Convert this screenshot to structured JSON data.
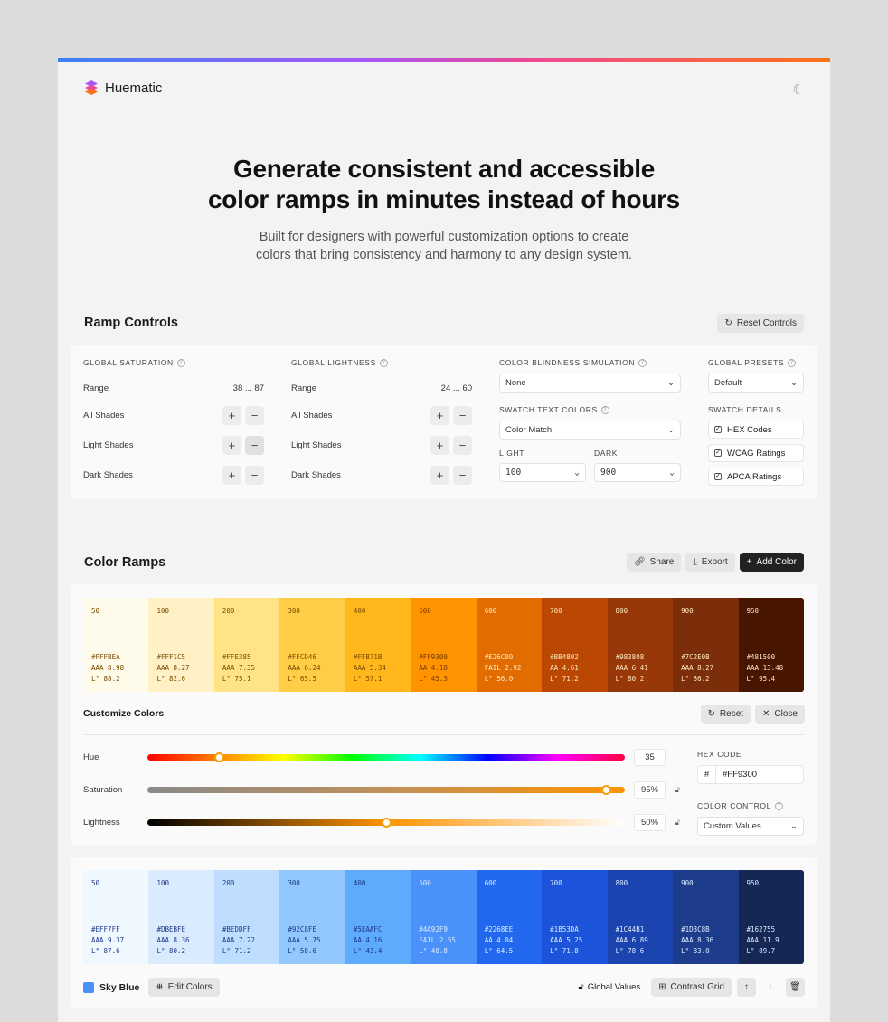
{
  "brand": {
    "name": "Huematic"
  },
  "hero": {
    "line1": "Generate consistent and accessible",
    "line2": "color ramps in minutes instead of hours",
    "sub1": "Built for designers with powerful customization options to create",
    "sub2": "colors that bring consistency and harmony to any design system."
  },
  "ramp_controls": {
    "title": "Ramp Controls",
    "reset": "Reset Controls",
    "sat": {
      "label": "Global Saturation",
      "range_label": "Range",
      "range": "38 ... 87"
    },
    "light": {
      "label": "Global Lightness",
      "range_label": "Range",
      "range": "24 ... 60"
    },
    "rows": [
      "All Shades",
      "Light Shades",
      "Dark Shades"
    ],
    "cb": {
      "label": "Color Blindness Simulation",
      "value": "None"
    },
    "stc": {
      "label": "Swatch Text Colors",
      "value": "Color Match",
      "light_label": "Light",
      "light_value": "100",
      "dark_label": "Dark",
      "dark_value": "900"
    },
    "presets": {
      "label": "Global Presets",
      "value": "Default"
    },
    "details": {
      "label": "Swatch Details",
      "items": [
        "HEX Codes",
        "WCAG Ratings",
        "APCA Ratings"
      ]
    }
  },
  "color_ramps": {
    "title": "Color Ramps",
    "share": "Share",
    "export": "Export",
    "add": "Add Color"
  },
  "orange": [
    {
      "n": "50",
      "hex": "#FFFBEA",
      "wcag": "AAA 8.98",
      "apca": "L° 88.2",
      "bg": "#FFFBEA",
      "fg": "#7a4a00"
    },
    {
      "n": "100",
      "hex": "#FFF1C5",
      "wcag": "AAA 8.27",
      "apca": "L° 82.6",
      "bg": "#FFF1C5",
      "fg": "#7a4a00"
    },
    {
      "n": "200",
      "hex": "#FFE385",
      "wcag": "AAA 7.35",
      "apca": "L° 75.1",
      "bg": "#FFE385",
      "fg": "#7a4a00"
    },
    {
      "n": "300",
      "hex": "#FFCD46",
      "wcag": "AAA 6.24",
      "apca": "L° 65.5",
      "bg": "#FFCD46",
      "fg": "#7a4a00"
    },
    {
      "n": "400",
      "hex": "#FFB71B",
      "wcag": "AAA 5.34",
      "apca": "L° 57.1",
      "bg": "#FFB71B",
      "fg": "#7a4a00"
    },
    {
      "n": "500",
      "hex": "#FF9300",
      "wcag": "AA 4.18",
      "apca": "L° 45.3",
      "bg": "#FF9300",
      "fg": "#7a3a00"
    },
    {
      "n": "600",
      "hex": "#E26C00",
      "wcag": "FAIL 2.92",
      "apca": "L° 56.0",
      "bg": "#E26C00",
      "fg": "#FFE8C0"
    },
    {
      "n": "700",
      "hex": "#BB4802",
      "wcag": "AA 4.61",
      "apca": "L° 71.2",
      "bg": "#BB4802",
      "fg": "#FFE8C0"
    },
    {
      "n": "800",
      "hex": "#983808",
      "wcag": "AAA 6.41",
      "apca": "L° 80.2",
      "bg": "#983808",
      "fg": "#FFE8C0"
    },
    {
      "n": "900",
      "hex": "#7C2E0B",
      "wcag": "AAA 8.27",
      "apca": "L° 86.2",
      "bg": "#7C2E0B",
      "fg": "#FFE8C0"
    },
    {
      "n": "950",
      "hex": "#481500",
      "wcag": "AAA 13.48",
      "apca": "L° 95.4",
      "bg": "#481500",
      "fg": "#FFE8C0"
    }
  ],
  "customize": {
    "title": "Customize Colors",
    "reset": "Reset",
    "close": "Close",
    "hue": {
      "label": "Hue",
      "value": "35",
      "fraction": 0.15
    },
    "sat": {
      "label": "Saturation",
      "value": "95%",
      "fraction": 0.96
    },
    "light": {
      "label": "Lightness",
      "value": "50%",
      "fraction": 0.5
    },
    "hex_label": "Hex Code",
    "hash": "#",
    "hex": "#FF9300",
    "cc_label": "Color Control",
    "cc_value": "Custom Values"
  },
  "blue": [
    {
      "n": "50",
      "hex": "#EFF7FF",
      "wcag": "AAA 9.37",
      "apca": "L° 87.6",
      "bg": "#EFF7FF",
      "fg": "#1e3a8a"
    },
    {
      "n": "100",
      "hex": "#DBEBFE",
      "wcag": "AAA 8.36",
      "apca": "L° 80.2",
      "bg": "#DBEBFE",
      "fg": "#1e3a8a"
    },
    {
      "n": "200",
      "hex": "#BEDDFF",
      "wcag": "AAA 7.22",
      "apca": "L° 71.2",
      "bg": "#BEDDFF",
      "fg": "#1e3a8a"
    },
    {
      "n": "300",
      "hex": "#92C8FE",
      "wcag": "AAA 5.75",
      "apca": "L° 58.6",
      "bg": "#92C8FE",
      "fg": "#1e3a8a"
    },
    {
      "n": "400",
      "hex": "#5EAAFC",
      "wcag": "AA 4.16",
      "apca": "L° 43.4",
      "bg": "#5EAAFC",
      "fg": "#1e3a8a"
    },
    {
      "n": "500",
      "hex": "#4A92F9",
      "wcag": "FAIL 2.55",
      "apca": "L° 48.8",
      "bg": "#4A92F9",
      "fg": "#DBEBFE"
    },
    {
      "n": "600",
      "hex": "#2268EE",
      "wcag": "AA 4.04",
      "apca": "L° 64.5",
      "bg": "#2268EE",
      "fg": "#DBEBFE"
    },
    {
      "n": "700",
      "hex": "#1B53DA",
      "wcag": "AAA 5.25",
      "apca": "L° 71.8",
      "bg": "#1B53DA",
      "fg": "#DBEBFE"
    },
    {
      "n": "800",
      "hex": "#1C44B1",
      "wcag": "AAA 6.89",
      "apca": "L° 78.6",
      "bg": "#1C44B1",
      "fg": "#DBEBFE"
    },
    {
      "n": "900",
      "hex": "#1D3C8B",
      "wcag": "AAA 8.36",
      "apca": "L° 83.0",
      "bg": "#1D3C8B",
      "fg": "#DBEBFE"
    },
    {
      "n": "950",
      "hex": "#162755",
      "wcag": "AAA 11.9",
      "apca": "L° 89.7",
      "bg": "#162755",
      "fg": "#DBEBFE"
    }
  ],
  "sky": {
    "name": "Sky Blue",
    "edit": "Edit Colors",
    "global": "Global Values",
    "grid": "Contrast Grid",
    "accent": "#4A92F9"
  }
}
